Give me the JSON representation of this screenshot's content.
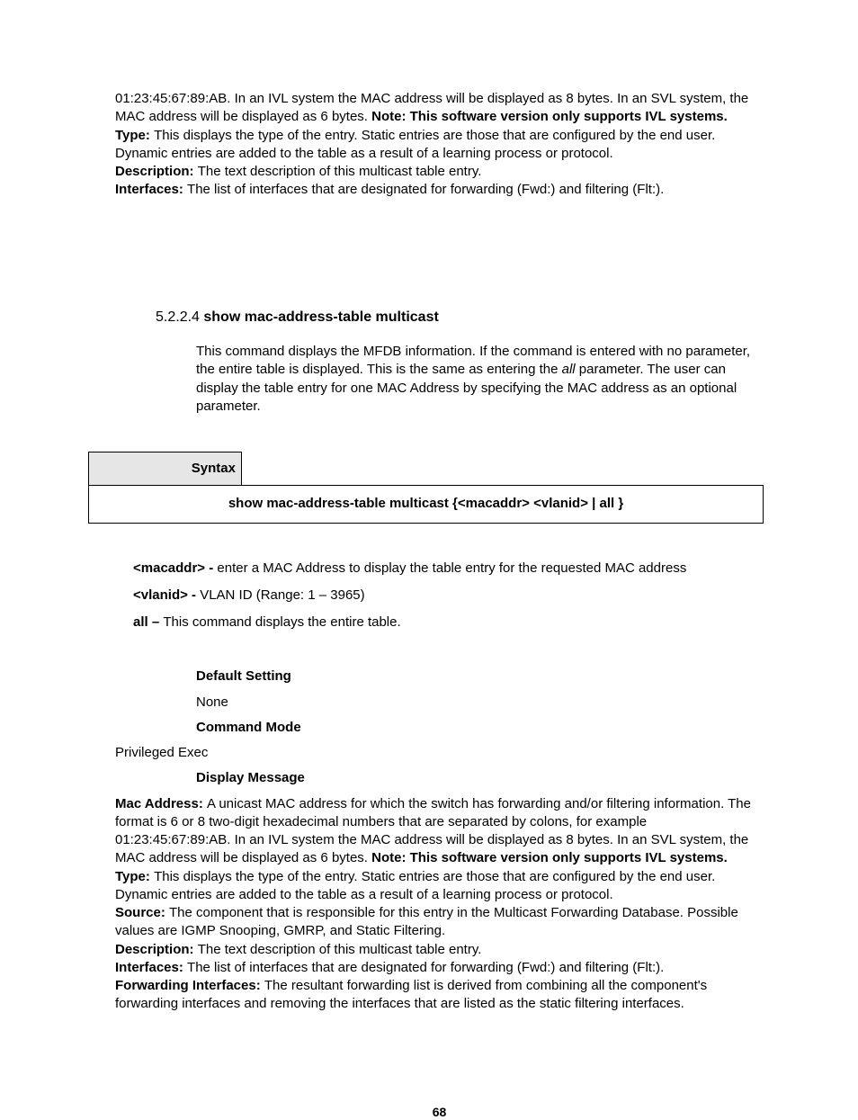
{
  "top": {
    "line1a": "01:23:45:67:89:AB. In an IVL system the MAC address will be displayed as 8 bytes. In an SVL system, the MAC address will be displayed as 6 bytes. ",
    "line1b": "Note: This software version only supports IVL systems.",
    "type_label": "Type: ",
    "type_text": "This displays the type of the entry. Static entries are those that are configured by the end user. Dynamic entries are added to the table as a result of a learning process or protocol.",
    "desc_label": "Description: ",
    "desc_text": "The text description of this multicast table entry.",
    "intf_label": "Interfaces: ",
    "intf_text": "The list of interfaces that are designated for forwarding (Fwd:) and filtering (Flt:)."
  },
  "section": {
    "number": "5.2.2.4 ",
    "title": "show mac-address-table multicast",
    "desc_a": "This command displays the MFDB information. If the command is entered with no parameter, the entire table is displayed. This is the same as entering the ",
    "desc_all": "all",
    "desc_b": " parameter. The user can display the table entry for one MAC Address by specifying the MAC address as an optional parameter."
  },
  "syntax": {
    "label": "Syntax",
    "command": "show mac-address-table multicast {<macaddr> <vlanid> | all }"
  },
  "params": {
    "mac_label": "<macaddr> - ",
    "mac_text": "enter a MAC Address to display the table entry for the requested MAC address",
    "vlan_label": "<vlanid> - ",
    "vlan_text": "VLAN ID (Range: 1 – 3965)",
    "all_label": "all – ",
    "all_text": "This command displays the entire table."
  },
  "defaults": {
    "ds_label": "Default Setting",
    "ds_value": "None",
    "cm_label": "Command Mode",
    "cm_value": "Privileged Exec",
    "dm_label": "Display Message"
  },
  "display": {
    "mac_label": "Mac Address: ",
    "mac_text": "A unicast MAC address for which the switch has forwarding and/or filtering information. The format is 6 or 8 two-digit hexadecimal numbers that are separated by colons, for example 01:23:45:67:89:AB. In an IVL system the MAC address will be displayed as 8 bytes. In an SVL system, the MAC address will be displayed as 6 bytes. ",
    "mac_note": "Note: This software version only supports IVL systems.",
    "type_label": "Type: ",
    "type_text": "This displays the type of the entry. Static entries are those that are configured by the end user. Dynamic entries are added to the table as a result of a learning process or protocol.",
    "src_label": "Source: ",
    "src_text": "The component that is responsible for this entry in the Multicast Forwarding Database. Possible values are IGMP Snooping, GMRP, and Static Filtering.",
    "desc_label": "Description: ",
    "desc_text": "The text description of this multicast table entry.",
    "intf_label": "Interfaces: ",
    "intf_text": "The list of interfaces that are designated for forwarding (Fwd:) and filtering (Flt:).",
    "fwd_label": "Forwarding Interfaces: ",
    "fwd_text": "The resultant forwarding list is derived from combining all the component's forwarding interfaces and removing the interfaces that are listed as the static filtering interfaces."
  },
  "page": "68"
}
